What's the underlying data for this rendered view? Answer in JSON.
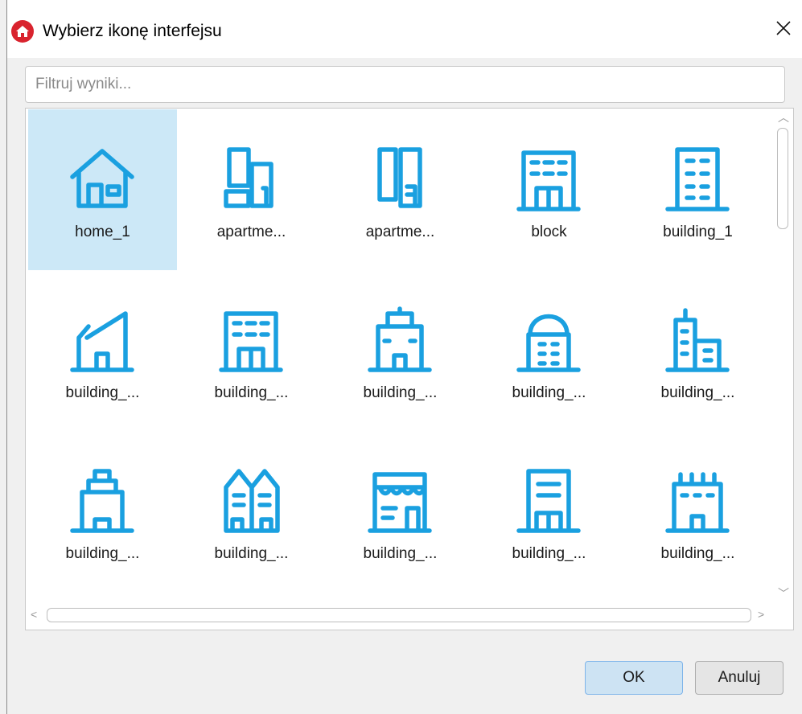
{
  "window": {
    "title": "Wybierz ikonę interfejsu",
    "app_icon": "home-circle-icon",
    "close_icon": "close-icon"
  },
  "search": {
    "placeholder": "Filtruj wyniki...",
    "value": ""
  },
  "colors": {
    "icon_blue": "#1aa0e0",
    "selection": "#cce8f7",
    "app_red": "#d9232e"
  },
  "icons": [
    {
      "label": "home_1",
      "icon": "house-icon",
      "selected": true
    },
    {
      "label": "apartme...",
      "icon": "apartment-1-icon",
      "selected": false
    },
    {
      "label": "apartme...",
      "icon": "apartment-2-icon",
      "selected": false
    },
    {
      "label": "block",
      "icon": "block-icon",
      "selected": false
    },
    {
      "label": "building_1",
      "icon": "building-1-icon",
      "selected": false
    },
    {
      "label": "building_...",
      "icon": "building-slant-icon",
      "selected": false
    },
    {
      "label": "building_...",
      "icon": "building-block-icon",
      "selected": false
    },
    {
      "label": "building_...",
      "icon": "building-gate-icon",
      "selected": false
    },
    {
      "label": "building_...",
      "icon": "building-dome-icon",
      "selected": false
    },
    {
      "label": "building_...",
      "icon": "building-towers-icon",
      "selected": false
    },
    {
      "label": "building_...",
      "icon": "building-tiered-icon",
      "selected": false
    },
    {
      "label": "building_...",
      "icon": "building-twin-icon",
      "selected": false
    },
    {
      "label": "building_...",
      "icon": "building-shop-icon",
      "selected": false
    },
    {
      "label": "building_...",
      "icon": "building-office-icon",
      "selected": false
    },
    {
      "label": "building_...",
      "icon": "building-factory-icon",
      "selected": false
    }
  ],
  "buttons": {
    "ok": "OK",
    "cancel": "Anuluj"
  }
}
